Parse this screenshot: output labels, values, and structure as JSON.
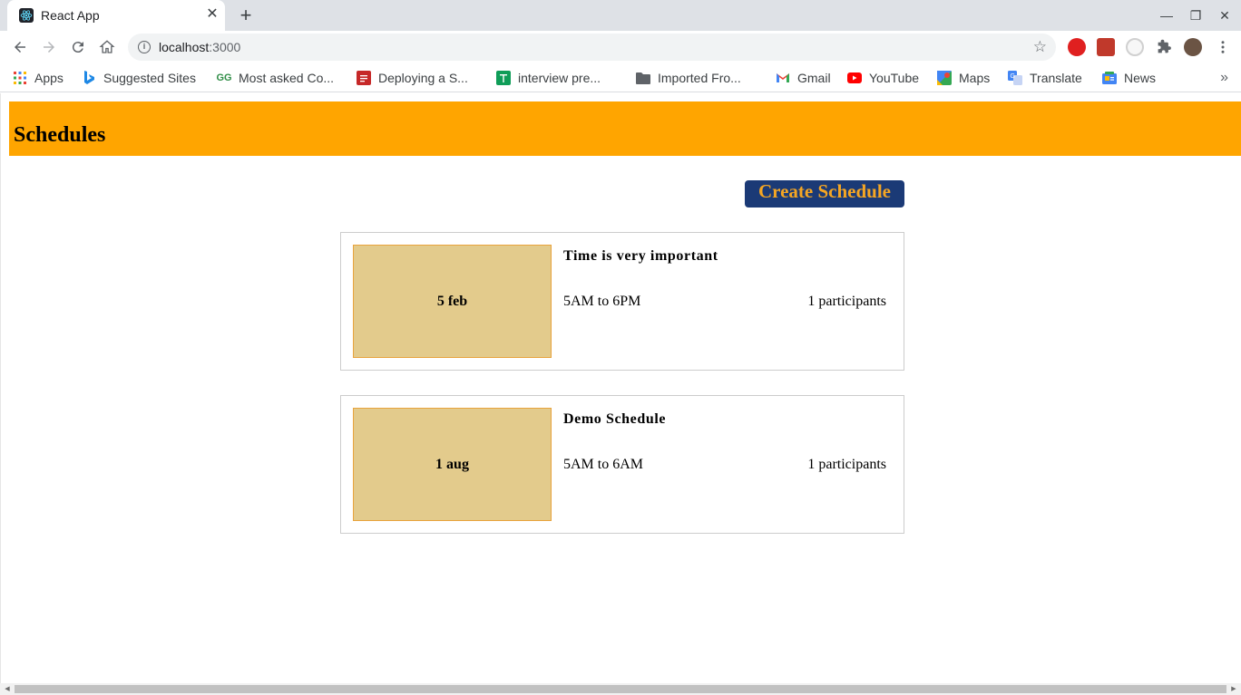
{
  "browser": {
    "tab_title": "React App",
    "tab_close": "✕",
    "new_tab": "+",
    "url_host": "localhost",
    "url_port": ":3000",
    "window_controls": {
      "minimize": "—",
      "restore": "❐",
      "close": "✕"
    },
    "bookmarks": [
      {
        "label": "Apps",
        "icon": "apps-grid-icon"
      },
      {
        "label": "Suggested Sites",
        "icon": "bing-icon"
      },
      {
        "label": "Most asked Co...",
        "icon": "geeksforgeeks-icon"
      },
      {
        "label": "Deploying a S...",
        "icon": "red-bookmark-icon"
      },
      {
        "label": "interview pre...",
        "icon": "sheets-icon"
      },
      {
        "label": "Imported Fro...",
        "icon": "folder-icon"
      },
      {
        "label": "Gmail",
        "icon": "gmail-icon"
      },
      {
        "label": "YouTube",
        "icon": "youtube-icon"
      },
      {
        "label": "Maps",
        "icon": "maps-icon"
      },
      {
        "label": "Translate",
        "icon": "translate-icon"
      },
      {
        "label": "News",
        "icon": "news-icon"
      }
    ],
    "bookmarks_more": "»"
  },
  "page": {
    "header_title": "Schedules",
    "create_button": "Create Schedule",
    "schedules": [
      {
        "date": "5 feb",
        "title": "Time is very important",
        "time": "5AM to 6PM",
        "participants": "1 participants"
      },
      {
        "date": "1 aug",
        "title": "Demo Schedule",
        "time": "5AM to 6AM",
        "participants": "1 participants"
      }
    ]
  },
  "colors": {
    "header_bg": "#ffa500",
    "button_bg": "#1b3a76",
    "button_text": "#f5a623",
    "date_box_bg": "#e3cb8c",
    "date_box_border": "#e8a33c"
  }
}
